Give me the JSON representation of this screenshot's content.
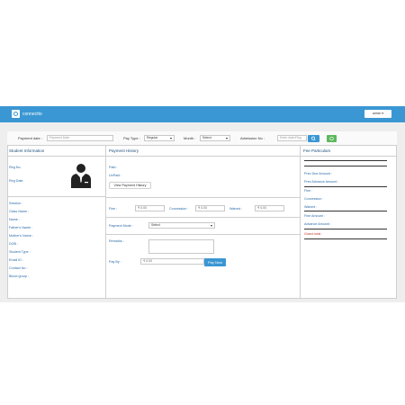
{
  "app": {
    "title": "connectto",
    "user_menu": "admin ▾"
  },
  "filter": {
    "payment_date_label": "Payment date :",
    "payment_date_placeholder": "Payment Date",
    "pay_type_label": "Pay Type :",
    "pay_type_value": "Regular",
    "month_label": "Month :",
    "month_value": "Select",
    "admission_label": "Admission No :",
    "admission_placeholder": "Enter Adm/Reg"
  },
  "student": {
    "title": "Student Information",
    "reg_no": "Reg No.",
    "reg_date": "Reg Date",
    "fields": [
      "Session :",
      "Class Name :",
      "Name :",
      "Father's Name :",
      "Mother's Name :",
      "DOB :",
      "Student Type :",
      "Email ID :",
      "Contact No :",
      "Blood group :"
    ]
  },
  "payment": {
    "title": "Payment History",
    "paid": "Paid :",
    "unpaid": "UnPaid :",
    "view_history": "View Payment History",
    "fine_label": "Fine :",
    "fine_value": "₹ 0.00",
    "concession_label": "Concession :",
    "concession_value": "₹ 0.00",
    "waived_label": "Waived :",
    "waived_value": "₹ 0.00",
    "mode_label": "Payment Mode :",
    "mode_value": "Select",
    "remarks_label": "Remarks :",
    "pay_by_label": "Pay By :",
    "pay_by_value": "₹ 0.00",
    "pay_now": "Pay Now"
  },
  "fee": {
    "title": "Fee Particulars",
    "prev_due": "Prev Due Amount :",
    "prev_advance": "Prev Advance Amount :",
    "fine": "Fine :",
    "concession": "Concession :",
    "waived": "Waived :",
    "fine_amount": "Fine Amount :",
    "advance_amount": "Advance Amount :",
    "grand_total": "Grand total :"
  },
  "colors": {
    "accent": "#3a97d3",
    "add": "#5cb85c",
    "label": "#2a6aa8",
    "total": "#c0392b"
  }
}
